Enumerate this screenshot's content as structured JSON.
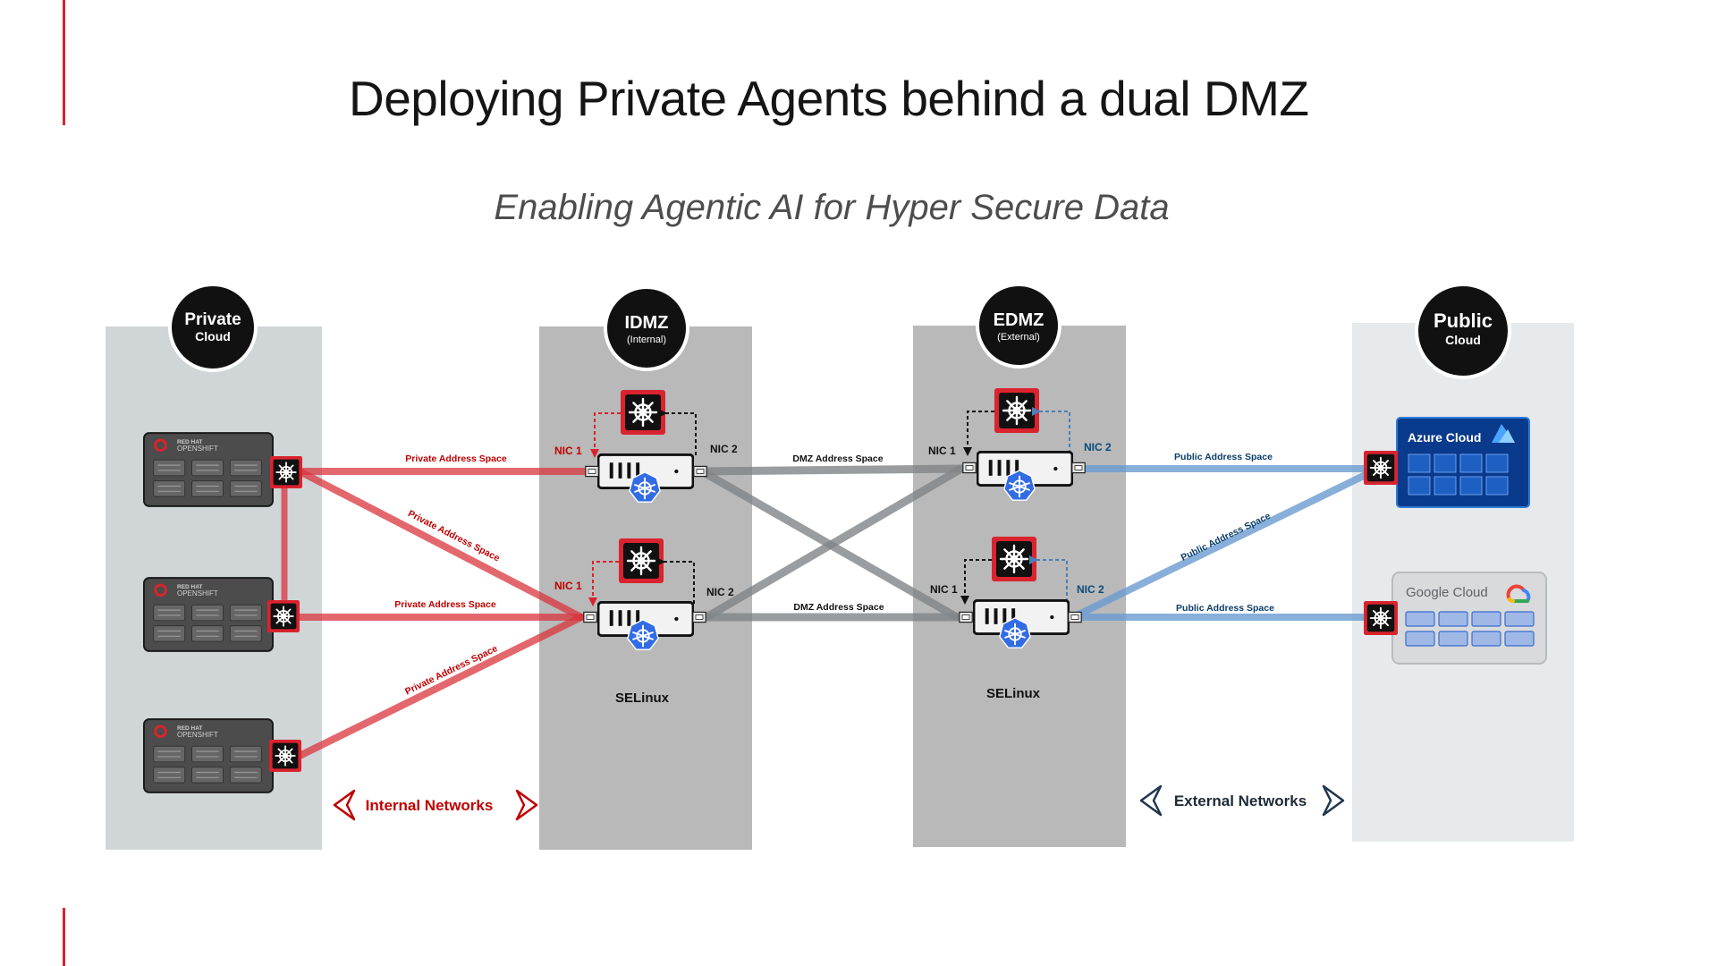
{
  "title": "Deploying Private Agents behind a dual DMZ",
  "subtitle": "Enabling Agentic AI for Hyper Secure Data",
  "zones": {
    "private": {
      "title": "Private",
      "sub": "Cloud"
    },
    "idmz": {
      "title": "IDMZ",
      "sub": "(Internal)",
      "os_label": "SELinux"
    },
    "edmz": {
      "title": "EDMZ",
      "sub": "(External)",
      "os_label": "SELinux"
    },
    "public": {
      "title": "Public",
      "sub": "Cloud"
    }
  },
  "openshift": {
    "line1": "RED HAT",
    "line2": "OPENSHIFT"
  },
  "nic": {
    "nic1": "NIC 1",
    "nic2": "NIC 2"
  },
  "links": {
    "private_address": "Private Address Space",
    "dmz_address": "DMZ Address Space",
    "public_address": "Public Address Space"
  },
  "networks": {
    "internal": "Internal Networks",
    "external": "External Networks"
  },
  "clouds": {
    "azure": "Azure Cloud",
    "google": "Google Cloud"
  },
  "colors": {
    "accent": "#d9232e",
    "private_link": "#d9363e",
    "dmz_link": "#8a8e91",
    "public_link": "#6a9bd1",
    "zone_light": "#d2d6d9",
    "zone_dark": "#b8b8b8",
    "azure": "#0a3a8c"
  },
  "icons": [
    "agent-helm-icon",
    "kubernetes-icon",
    "server-icon",
    "openshift-icon",
    "azure-icon",
    "google-cloud-icon",
    "chevron-left-icon",
    "chevron-right-icon"
  ]
}
